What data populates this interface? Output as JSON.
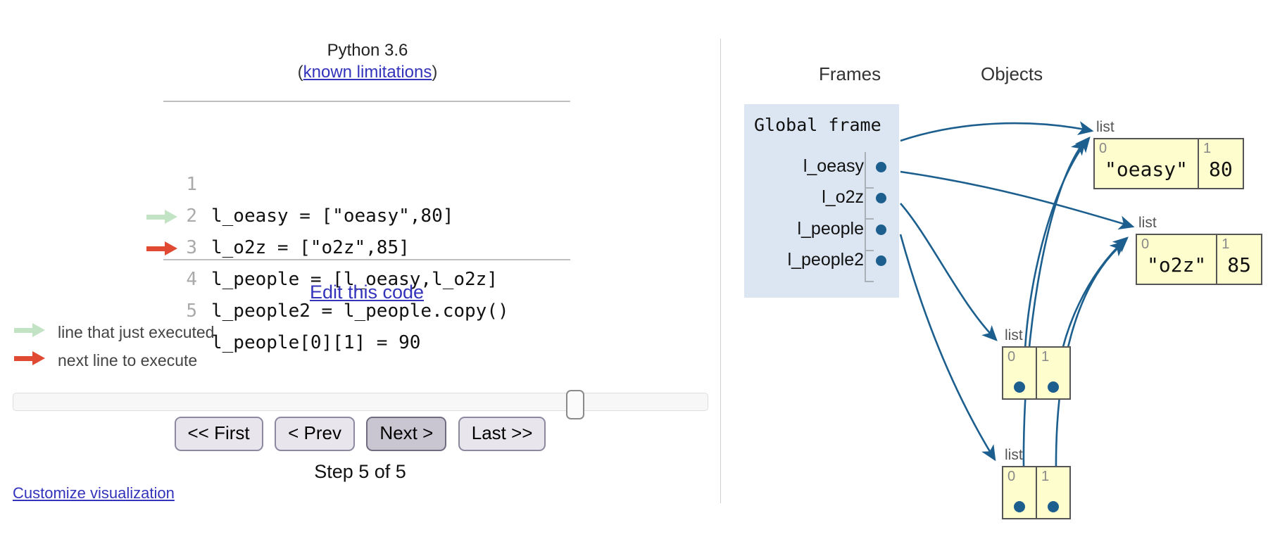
{
  "left": {
    "python_version": "Python 3.6",
    "limits_prefix": "(",
    "limits_link": "known limitations",
    "limits_suffix": ")",
    "code_lines": [
      {
        "n": "1",
        "text": "l_oeasy = [\"oeasy\",80]",
        "marker": "none"
      },
      {
        "n": "2",
        "text": "l_o2z = [\"o2z\",85]",
        "marker": "none"
      },
      {
        "n": "3",
        "text": "l_people = [l_oeasy,l_o2z]",
        "marker": "none"
      },
      {
        "n": "4",
        "text": "l_people2 = l_people.copy()",
        "marker": "green"
      },
      {
        "n": "5",
        "text": "l_people[0][1] = 90",
        "marker": "red"
      }
    ],
    "edit_link": "Edit this code",
    "legend": [
      {
        "marker": "green",
        "label": "line that just executed"
      },
      {
        "marker": "red",
        "label": "next line to execute"
      }
    ],
    "buttons": [
      {
        "label": "<< First",
        "active": false
      },
      {
        "label": "< Prev",
        "active": false
      },
      {
        "label": "Next >",
        "active": true
      },
      {
        "label": "Last >>",
        "active": false
      }
    ],
    "step_label": "Step 5 of 5",
    "customize_link": "Customize visualization",
    "slider": {
      "position_percent": 80
    }
  },
  "right": {
    "frames_header": "Frames",
    "objects_header": "Objects",
    "frame_title": "Global frame",
    "variables": [
      {
        "name": "l_oeasy"
      },
      {
        "name": "l_o2z"
      },
      {
        "name": "l_people"
      },
      {
        "name": "l_people2"
      }
    ],
    "objects": [
      {
        "id": "obj-oeasy",
        "type_label": "list",
        "cells": [
          {
            "index": "0",
            "kind": "value",
            "value": "\"oeasy\""
          },
          {
            "index": "1",
            "kind": "value",
            "value": "80"
          }
        ]
      },
      {
        "id": "obj-o2z",
        "type_label": "list",
        "cells": [
          {
            "index": "0",
            "kind": "value",
            "value": "\"o2z\""
          },
          {
            "index": "1",
            "kind": "value",
            "value": "85"
          }
        ]
      },
      {
        "id": "obj-people",
        "type_label": "list",
        "cells": [
          {
            "index": "0",
            "kind": "pointer",
            "value": ""
          },
          {
            "index": "1",
            "kind": "pointer",
            "value": ""
          }
        ]
      },
      {
        "id": "obj-people2",
        "type_label": "list",
        "cells": [
          {
            "index": "0",
            "kind": "pointer",
            "value": ""
          },
          {
            "index": "1",
            "kind": "pointer",
            "value": ""
          }
        ]
      }
    ],
    "colors": {
      "frame_bg": "#dce6f2",
      "object_bg": "#fdfdcd",
      "object_border": "#555555",
      "pointer": "#1c5f8e",
      "green_arrow": "#c3e4c4",
      "red_arrow": "#e04a32",
      "link": "#3333bb"
    }
  }
}
